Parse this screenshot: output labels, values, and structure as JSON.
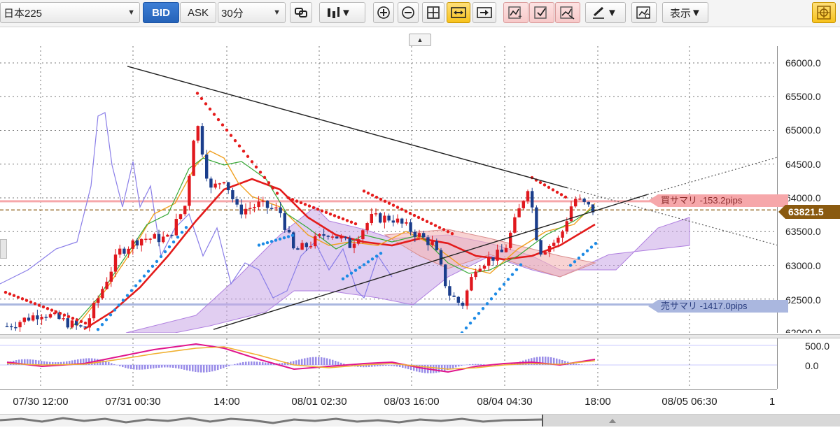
{
  "toolbar": {
    "symbol": "日本225",
    "bid_label": "BID",
    "ask_label": "ASK",
    "timeframe": "30分",
    "view_label": "表示"
  },
  "price_axis": {
    "labels": [
      "66000.0",
      "65500.0",
      "65000.0",
      "64500.0",
      "64000.0",
      "63500.0",
      "63000.0",
      "62500.0",
      "62000.0"
    ],
    "current_price": "63821.5"
  },
  "summary": {
    "buy": "買サマリ -153.2pips",
    "sell": "売サマリ -1417.0pips"
  },
  "oscillator_axis": {
    "labels": [
      "500.0",
      "0.0"
    ]
  },
  "time_axis": {
    "labels": [
      "07/30 12:00",
      "07/31 00:30",
      "14:00",
      "08/01 02:30",
      "08/03 16:00",
      "08/04 04:30",
      "18:00",
      "08/05 06:30",
      "1"
    ]
  },
  "colors": {
    "bid": "#2563b8",
    "buy_zone": "#f6a7aa",
    "sell_zone": "#aab7df",
    "candle_up": "#e0181e",
    "candle_down": "#1b3e8c",
    "ma_red": "#e31b1b",
    "cloud": "#c9a6e6",
    "current_price": "#8a5a10"
  }
}
